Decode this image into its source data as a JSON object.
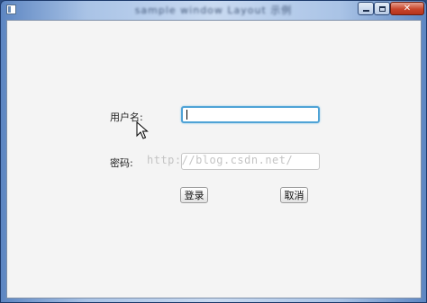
{
  "window": {
    "title": "sample window Layout 示例",
    "controls": {
      "minimize": "",
      "maximize": "",
      "close": "✕"
    }
  },
  "form": {
    "username_label": "用户名:",
    "username_value": "",
    "password_label": "密码:",
    "password_value": "",
    "login_button": "登录",
    "cancel_button": "取消"
  },
  "watermark": "http://blog.csdn.net/",
  "colors": {
    "focus_border": "#4fa3d6",
    "client_background": "#f4f4f4",
    "close_button": "#c8452b"
  },
  "icons": [
    "app-icon",
    "minimize-icon",
    "maximize-icon",
    "close-icon",
    "mouse-pointer-icon"
  ]
}
